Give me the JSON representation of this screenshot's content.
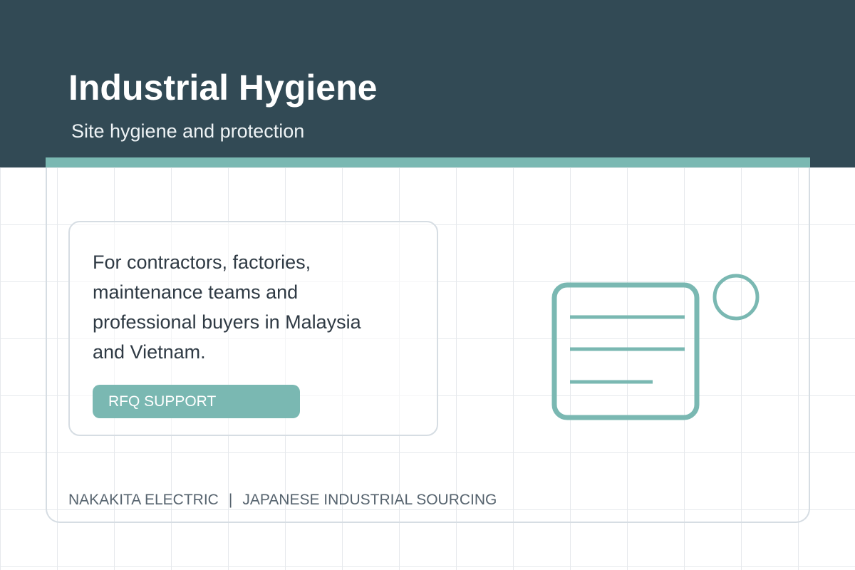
{
  "header": {
    "title": "Industrial Hygiene",
    "subtitle": "Site hygiene and protection"
  },
  "card": {
    "text": "For contractors, factories, maintenance teams and professional buyers in Malaysia and Vietnam.",
    "button_label": "RFQ SUPPORT"
  },
  "footer": {
    "company": "NAKAKITA ELECTRIC",
    "separator": "|",
    "tagline": "JAPANESE INDUSTRIAL SOURCING"
  },
  "icons": {
    "illustration": "document-lines-icon",
    "badge": "circle-icon"
  },
  "colors": {
    "header_bg": "#324a55",
    "accent": "#7ab8b2",
    "text_dark": "#2f3a44",
    "text_muted": "#56636e"
  }
}
